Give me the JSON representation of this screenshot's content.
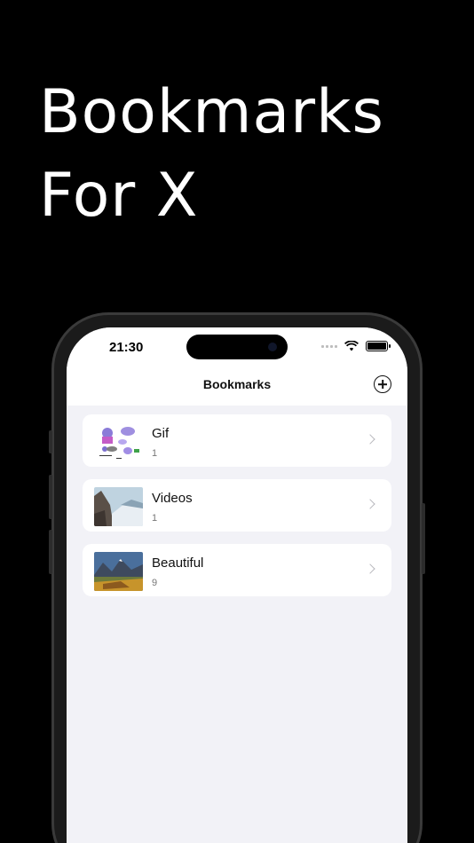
{
  "promo": {
    "line1": "Bookmarks",
    "line2": "For X"
  },
  "status_bar": {
    "time": "21:30"
  },
  "nav": {
    "title": "Bookmarks",
    "add_icon": "plus-circle-icon"
  },
  "collections": [
    {
      "title": "Gif",
      "count": "1",
      "thumbnail": "gif-stickers"
    },
    {
      "title": "Videos",
      "count": "1",
      "thumbnail": "mountain-cliff-snow"
    },
    {
      "title": "Beautiful",
      "count": "9",
      "thumbnail": "mountain-valley-autumn"
    }
  ],
  "colors": {
    "background": "#000000",
    "list_bg": "#f2f2f7",
    "card_bg": "#ffffff",
    "chevron": "#b8b8bd"
  }
}
